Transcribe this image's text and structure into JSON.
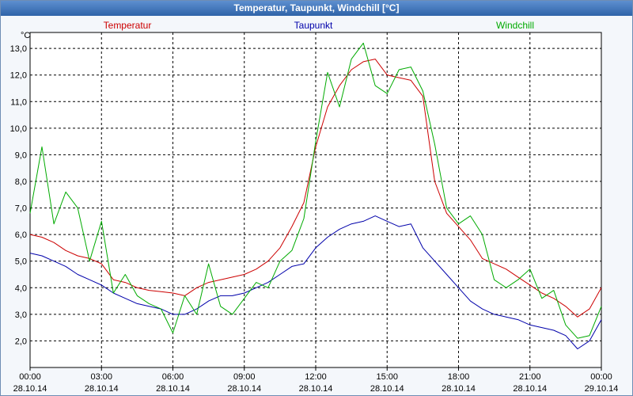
{
  "title": "Temperatur, Taupunkt, Windchill [°C]",
  "chart_data": {
    "type": "line",
    "ylabel": "°C",
    "ylim": [
      1.0,
      13.6
    ],
    "xlim": [
      "28.10.14 00:00",
      "29.10.14 00:00"
    ],
    "yticks": [
      "13,0",
      "12,0",
      "11,0",
      "10,0",
      "9,0",
      "8,0",
      "7,0",
      "6,0",
      "5,0",
      "4,0",
      "3,0",
      "2,0"
    ],
    "ytick_values": [
      13,
      12,
      11,
      10,
      9,
      8,
      7,
      6,
      5,
      4,
      3,
      2
    ],
    "xticks": [
      {
        "time": "00:00",
        "date": "28.10.14"
      },
      {
        "time": "03:00",
        "date": "28.10.14"
      },
      {
        "time": "06:00",
        "date": "28.10.14"
      },
      {
        "time": "09:00",
        "date": "28.10.14"
      },
      {
        "time": "12:00",
        "date": "28.10.14"
      },
      {
        "time": "15:00",
        "date": "28.10.14"
      },
      {
        "time": "18:00",
        "date": "28.10.14"
      },
      {
        "time": "21:00",
        "date": "28.10.14"
      },
      {
        "time": "00:00",
        "date": "29.10.14"
      }
    ],
    "grid": true,
    "series": [
      {
        "name": "Temperatur",
        "color": "#cc0000",
        "x": [
          "00:00",
          "00:30",
          "01:00",
          "01:30",
          "02:00",
          "02:30",
          "03:00",
          "03:30",
          "04:00",
          "04:30",
          "05:00",
          "05:30",
          "06:00",
          "06:30",
          "07:00",
          "07:30",
          "08:00",
          "08:30",
          "09:00",
          "09:30",
          "10:00",
          "10:30",
          "11:00",
          "11:30",
          "12:00",
          "12:30",
          "13:00",
          "13:30",
          "14:00",
          "14:30",
          "15:00",
          "15:30",
          "16:00",
          "16:30",
          "17:00",
          "17:30",
          "18:00",
          "18:30",
          "19:00",
          "19:30",
          "20:00",
          "20:30",
          "21:00",
          "21:30",
          "22:00",
          "22:30",
          "23:00",
          "23:30",
          "24:00"
        ],
        "values": [
          6.0,
          5.9,
          5.7,
          5.4,
          5.2,
          5.1,
          4.9,
          4.3,
          4.2,
          4.0,
          3.9,
          3.85,
          3.8,
          3.7,
          4.0,
          4.2,
          4.3,
          4.4,
          4.5,
          4.7,
          5.0,
          5.5,
          6.3,
          7.2,
          9.3,
          10.8,
          11.6,
          12.2,
          12.5,
          12.6,
          12.0,
          11.9,
          11.8,
          11.2,
          8.0,
          6.8,
          6.3,
          5.8,
          5.1,
          4.9,
          4.7,
          4.4,
          4.1,
          3.8,
          3.6,
          3.3,
          2.9,
          3.2,
          4.0
        ]
      },
      {
        "name": "Taupunkt",
        "color": "#0000aa",
        "x": [
          "00:00",
          "00:30",
          "01:00",
          "01:30",
          "02:00",
          "02:30",
          "03:00",
          "03:30",
          "04:00",
          "04:30",
          "05:00",
          "05:30",
          "06:00",
          "06:30",
          "07:00",
          "07:30",
          "08:00",
          "08:30",
          "09:00",
          "09:30",
          "10:00",
          "10:30",
          "11:00",
          "11:30",
          "12:00",
          "12:30",
          "13:00",
          "13:30",
          "14:00",
          "14:30",
          "15:00",
          "15:30",
          "16:00",
          "16:30",
          "17:00",
          "17:30",
          "18:00",
          "18:30",
          "19:00",
          "19:30",
          "20:00",
          "20:30",
          "21:00",
          "21:30",
          "22:00",
          "22:30",
          "23:00",
          "23:30",
          "24:00"
        ],
        "values": [
          5.3,
          5.2,
          5.0,
          4.8,
          4.5,
          4.3,
          4.1,
          3.8,
          3.6,
          3.4,
          3.3,
          3.2,
          3.0,
          3.0,
          3.2,
          3.5,
          3.7,
          3.7,
          3.8,
          4.0,
          4.2,
          4.5,
          4.8,
          4.9,
          5.5,
          5.9,
          6.2,
          6.4,
          6.5,
          6.7,
          6.5,
          6.3,
          6.4,
          5.5,
          5.0,
          4.5,
          4.0,
          3.5,
          3.2,
          3.0,
          2.9,
          2.8,
          2.6,
          2.5,
          2.4,
          2.2,
          1.7,
          2.0,
          2.8
        ]
      },
      {
        "name": "Windchill",
        "color": "#00aa00",
        "x": [
          "00:00",
          "00:30",
          "01:00",
          "01:30",
          "02:00",
          "02:30",
          "03:00",
          "03:30",
          "04:00",
          "04:30",
          "05:00",
          "05:30",
          "06:00",
          "06:30",
          "07:00",
          "07:30",
          "08:00",
          "08:30",
          "09:00",
          "09:30",
          "10:00",
          "10:30",
          "11:00",
          "11:30",
          "12:00",
          "12:30",
          "13:00",
          "13:30",
          "14:00",
          "14:30",
          "15:00",
          "15:30",
          "16:00",
          "16:30",
          "17:00",
          "17:30",
          "18:00",
          "18:30",
          "19:00",
          "19:30",
          "20:00",
          "20:30",
          "21:00",
          "21:30",
          "22:00",
          "22:30",
          "23:00",
          "23:30",
          "24:00"
        ],
        "values": [
          6.8,
          9.3,
          6.4,
          7.6,
          7.0,
          5.0,
          6.5,
          3.8,
          4.5,
          3.7,
          3.4,
          3.2,
          2.3,
          3.7,
          3.0,
          4.9,
          3.3,
          3.0,
          3.6,
          4.2,
          4.0,
          5.0,
          5.4,
          6.6,
          9.5,
          12.1,
          10.8,
          12.6,
          13.2,
          11.6,
          11.3,
          12.2,
          12.3,
          11.4,
          9.4,
          7.0,
          6.4,
          6.7,
          6.0,
          4.3,
          4.0,
          4.3,
          4.7,
          3.6,
          3.9,
          2.6,
          2.1,
          2.2,
          3.3
        ]
      }
    ]
  }
}
